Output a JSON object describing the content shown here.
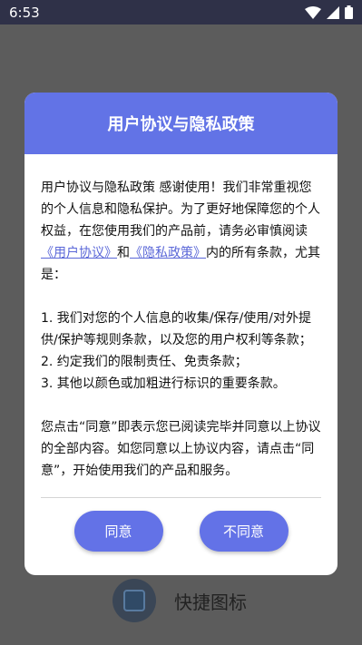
{
  "status_bar": {
    "time": "6:53"
  },
  "background_app": {
    "label": "快捷图标"
  },
  "dialog": {
    "title": "用户协议与隐私政策",
    "intro_pre": "用户协议与隐私政策 感谢使用！我们非常重视您的个人信息和隐私保护。为了更好地保障您的个人权益，在您使用我们的产品前，请务必审慎阅读",
    "link_user_agreement": "《用户协议》",
    "and_text": "和",
    "link_privacy_policy": "《隐私政策》",
    "intro_post": "内的所有条款，尤其是：",
    "clauses": [
      "1. 我们对您的个人信息的收集/保存/使用/对外提供/保护等规则条款，以及您的用户权利等条款；",
      "2. 约定我们的限制责任、免责条款；",
      "3. 其他以颜色或加粗进行标识的重要条款。"
    ],
    "closing": "您点击“同意”即表示您已阅读完毕并同意以上协议的全部内容。如您同意以上协议内容，请点击“同意”，开始使用我们的产品和服务。",
    "agree_label": "同意",
    "disagree_label": "不同意"
  },
  "colors": {
    "accent": "#6273e6",
    "overlay": "#5c5c5c",
    "status_bar": "#2f3148"
  }
}
